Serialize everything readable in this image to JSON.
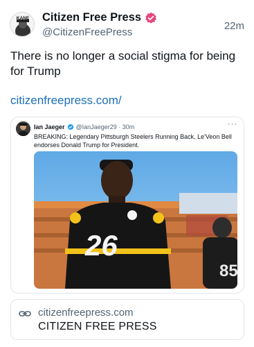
{
  "post": {
    "author": {
      "display_name": "Citizen Free Press",
      "handle": "@CitizenFreePress",
      "avatar_text": "KANE",
      "verified_color": "#e8457a"
    },
    "timestamp": "22m",
    "text": "There is no longer a social stigma for being for Trump",
    "link_text": "citizenfreepress.com/",
    "link_color": "#1d6fb8"
  },
  "quoted_post": {
    "author_name": "Ian Jaeger",
    "handle_time": "@IanJaeger29 · 30m",
    "verified_color": "#1d9bf0",
    "more_label": "···",
    "text": "BREAKING: Legendary Pittsburgh Steelers Running Back, Le'Veon Bell endorses Donald Trump for President.",
    "image": {
      "jersey_number": "26",
      "background_jersey_number": "85"
    }
  },
  "link_card": {
    "icon": "link-icon",
    "domain": "citizenfreepress.com",
    "title": "CITIZEN FREE PRESS"
  }
}
